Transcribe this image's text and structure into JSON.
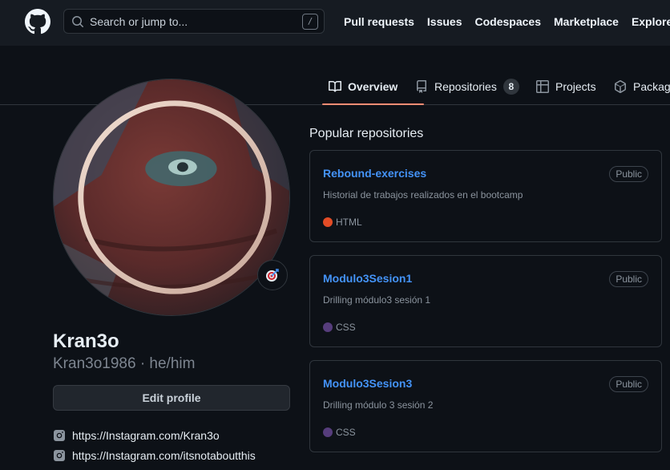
{
  "header": {
    "search_placeholder": "Search or jump to...",
    "search_shortcut": "/",
    "nav": [
      "Pull requests",
      "Issues",
      "Codespaces",
      "Marketplace",
      "Explore"
    ]
  },
  "tabs": {
    "overview": "Overview",
    "repositories": "Repositories",
    "repositories_count": "8",
    "projects": "Projects",
    "packages": "Packages"
  },
  "profile": {
    "name": "Kran3o",
    "login_line": "Kran3o1986 · he/him",
    "edit_button": "Edit profile",
    "social_links": [
      "https://Instagram.com/Kran3o",
      "https://Instagram.com/itsnotaboutthis"
    ]
  },
  "popular": {
    "title": "Popular repositories",
    "repos": [
      {
        "name": "Rebound-exercises",
        "visibility": "Public",
        "description": "Historial de trabajos realizados en el bootcamp",
        "language": "HTML",
        "language_color": "#e34c26"
      },
      {
        "name": "Modulo3Sesion1",
        "visibility": "Public",
        "description": "Drilling módulo3 sesión 1",
        "language": "CSS",
        "language_color": "#563d7c"
      },
      {
        "name": "Modulo3Sesion3",
        "visibility": "Public",
        "description": "Drilling módulo 3 sesión 2",
        "language": "CSS",
        "language_color": "#563d7c"
      }
    ]
  },
  "colors": {
    "background": "#0d1117",
    "header": "#161b22",
    "link": "#4493f8",
    "tab_underline": "#fd8c73"
  },
  "icons": [
    "github-logo-icon",
    "search-icon",
    "book-icon",
    "repo-icon",
    "table-icon",
    "package-icon",
    "target-icon",
    "instagram-icon"
  ]
}
